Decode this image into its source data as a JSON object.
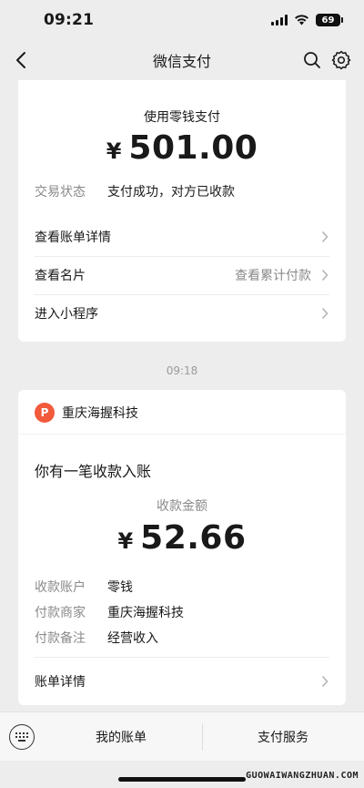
{
  "status_bar": {
    "time": "09:21",
    "battery": "69"
  },
  "nav": {
    "title": "微信支付"
  },
  "payment_card": {
    "method": "使用零钱支付",
    "currency": "¥",
    "amount": "501.00",
    "status_label": "交易状态",
    "status_value": "支付成功，对方已收款",
    "bill_detail": "查看账单详情",
    "business_card": "查看名片",
    "cumulative": "查看累计付款",
    "mini_program": "进入小程序"
  },
  "timestamp": "09:18",
  "receipt_card": {
    "merchant": "重庆海握科技",
    "logo_text": "P",
    "notice": "你有一笔收款入账",
    "amount_label": "收款金额",
    "currency": "¥",
    "amount": "52.66",
    "rows": [
      {
        "label": "收款账户",
        "value": "零钱"
      },
      {
        "label": "付款商家",
        "value": "重庆海握科技"
      },
      {
        "label": "付款备注",
        "value": "经营收入"
      }
    ],
    "bill_detail": "账单详情"
  },
  "bottom_bar": {
    "my_bills": "我的账单",
    "pay_services": "支付服务"
  },
  "watermark": "GUOWAIWANGZHUAN.COM"
}
